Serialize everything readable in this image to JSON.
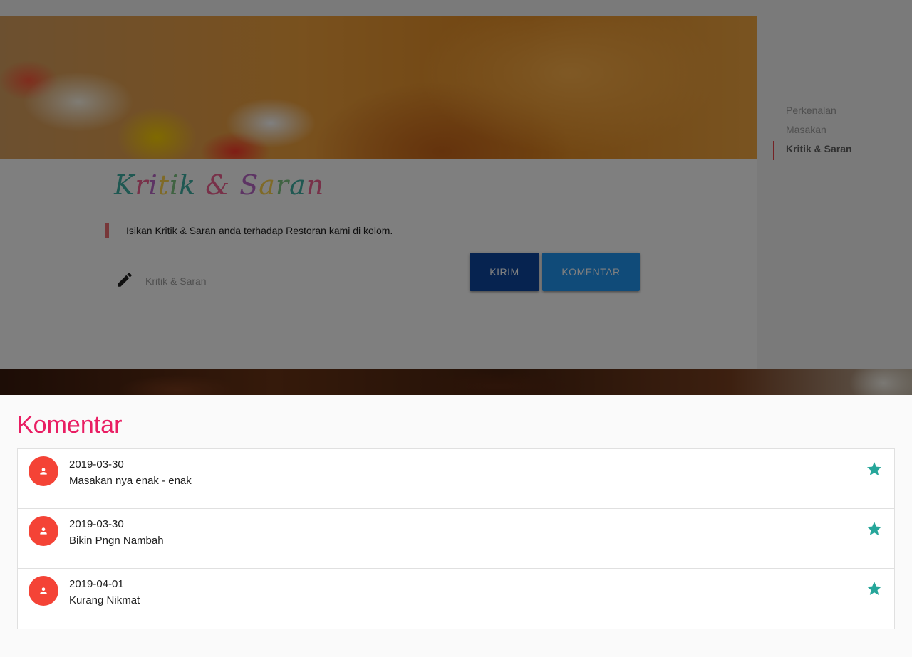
{
  "nav": {
    "items": [
      {
        "label": "Perkenalan",
        "active": false
      },
      {
        "label": "Masakan",
        "active": false
      },
      {
        "label": "Kritik & Saran",
        "active": true
      }
    ]
  },
  "kritik": {
    "title": "Kritik & Saran",
    "description": "Isikan Kritik & Saran anda terhadap Restoran kami di kolom.",
    "input_placeholder": "Kritik & Saran",
    "input_value": "",
    "kirim_label": "KIRIM",
    "komentar_label": "KOMENTAR"
  },
  "comments": {
    "title": "Komentar",
    "items": [
      {
        "date": "2019-03-30",
        "text": "Masakan nya enak - enak"
      },
      {
        "date": "2019-03-30",
        "text": "Bikin Pngn Nambah"
      },
      {
        "date": "2019-04-01",
        "text": "Kurang Nikmat"
      }
    ]
  },
  "colors": {
    "accent_pink": "#e91e63",
    "avatar_red": "#f44336",
    "star_teal": "#26a69a",
    "kirim_blue": "#0d47a1",
    "komentar_blue": "#2196f3"
  },
  "icons": {
    "input": "pencil-icon",
    "avatar": "person-icon",
    "action": "star-icon"
  }
}
